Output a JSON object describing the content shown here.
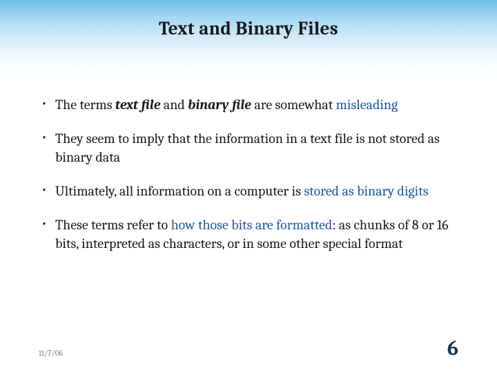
{
  "title": "Text and Binary Files",
  "bullets": [
    {
      "pre": "The terms ",
      "em1": "text file",
      "mid1": " and ",
      "em2": "binary file",
      "mid2": " are somewhat ",
      "hl": "misleading",
      "post": ""
    },
    {
      "pre": "They seem to imply that the information in a text file is not stored as binary data",
      "em1": "",
      "mid1": "",
      "em2": "",
      "mid2": "",
      "hl": "",
      "post": ""
    },
    {
      "pre": "Ultimately, all information on a computer is ",
      "em1": "",
      "mid1": "",
      "em2": "",
      "mid2": "",
      "hl": "stored as binary digits",
      "post": ""
    },
    {
      "pre": "These terms refer to ",
      "em1": "",
      "mid1": "",
      "em2": "",
      "mid2": "",
      "hl": "how those bits are formatted",
      "post": ": as chunks of 8 or 16 bits, interpreted as characters, or in some other special format"
    }
  ],
  "footer": {
    "date": "11/7/06",
    "page": "6"
  }
}
